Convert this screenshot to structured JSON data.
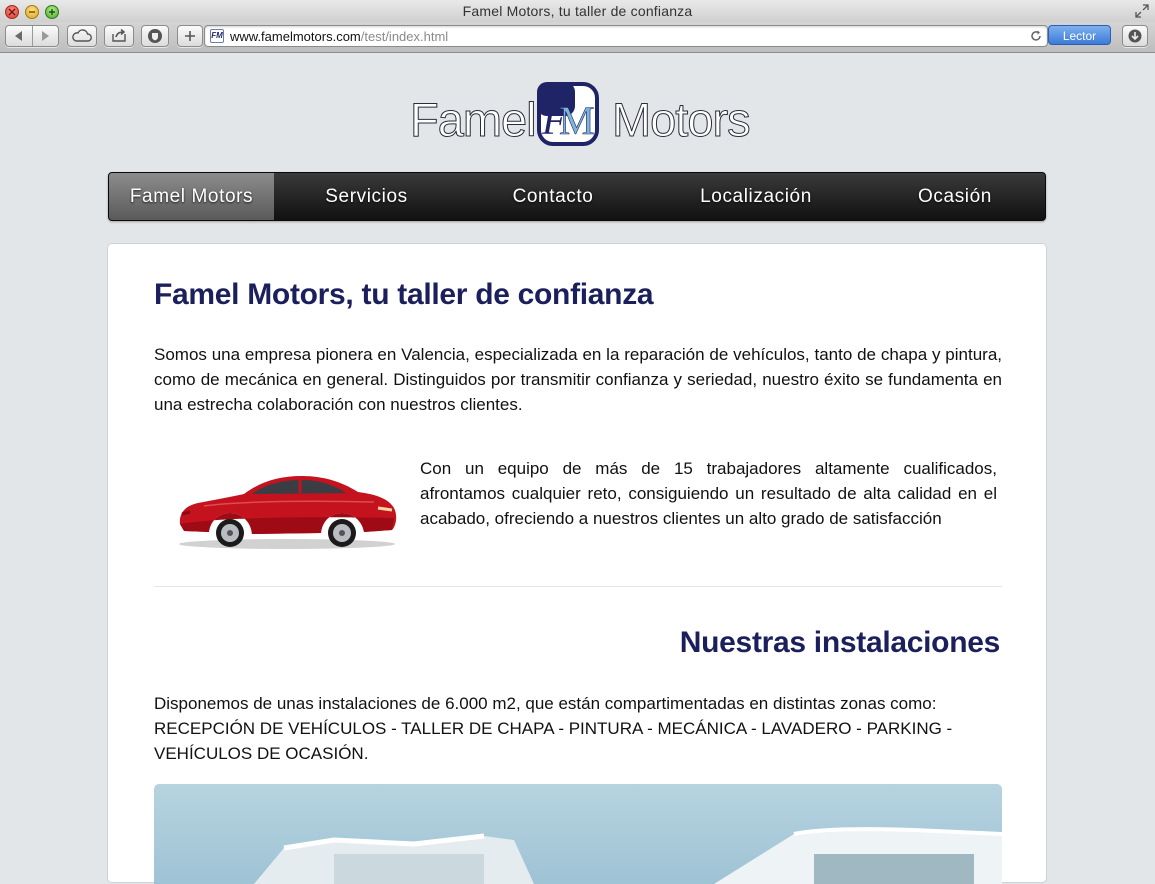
{
  "window": {
    "title": "Famel Motors, tu taller de confianza"
  },
  "toolbar": {
    "url_domain": "www.famelmotors.com",
    "url_path": "/test/index.html",
    "reader_label": "Lector",
    "icons": [
      "back-icon",
      "forward-icon",
      "cloud-icon",
      "share-icon",
      "shield-icon",
      "plus-icon",
      "reload-icon",
      "download-icon"
    ]
  },
  "logo": {
    "word_left": "Famel",
    "word_right": "Motors",
    "monogram": "FM"
  },
  "nav": {
    "items": [
      {
        "label": "Famel Motors",
        "active": true
      },
      {
        "label": "Servicios"
      },
      {
        "label": "Contacto"
      },
      {
        "label": "Localización"
      },
      {
        "label": "Ocasión"
      }
    ]
  },
  "main": {
    "heading": "Famel Motors, tu taller de confianza",
    "intro": "Somos una empresa pionera en Valencia, especializada en la reparación de vehículos, tanto de chapa y pintura, como de mecánica en general. Distinguidos por transmitir confianza y seriedad, nuestro éxito se fundamenta en una estrecha colaboración con nuestros clientes.",
    "team_text": "Con un equipo de más de 15 trabajadores altamente cualificados, afrontamos cualquier reto, consiguiendo un resultado de alta calidad en el acabado, ofreciendo a nuestros clientes un alto grado de satisfacción",
    "facilities_heading": "Nuestras instalaciones",
    "facilities_text_1": "Disponemos de unas instalaciones de 6.000 m2, que están compartimentadas en distintas zonas como:",
    "facilities_text_2": "RECEPCIÓN DE VEHÍCULOS - TALLER DE CHAPA - PINTURA - MECÁNICA - LAVADERO - PARKING - VEHÍCULOS DE OCASIÓN."
  },
  "colors": {
    "heading": "#1b1f5c",
    "nav_bg": "#1a1a1a",
    "nav_active": "#7a7a7a",
    "reader_button": "#4a86e0"
  }
}
